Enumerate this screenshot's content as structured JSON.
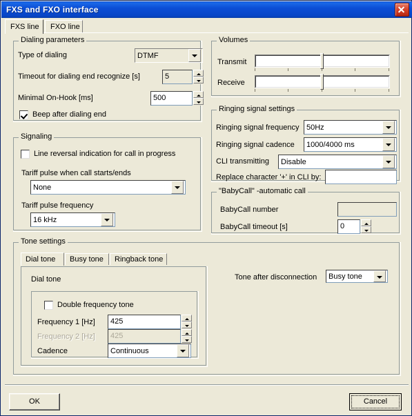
{
  "window": {
    "title": "FXS and FXO interface",
    "close_label": "Close"
  },
  "tabs": [
    {
      "label": "FXS line",
      "selected": true
    },
    {
      "label": "FXO line",
      "selected": false
    }
  ],
  "dialing": {
    "legend": "Dialing parameters",
    "type_label": "Type of dialing",
    "type_value": "DTMF",
    "timeout_label": "Timeout for dialing end recognize [s]",
    "timeout_value": "5",
    "onhook_label": "Minimal On-Hook [ms]",
    "onhook_value": "500",
    "beep_label": "Beep after dialing end",
    "beep_checked": true
  },
  "signaling": {
    "legend": "Signaling",
    "line_reversal_label": "Line reversal indication for call in progress",
    "line_reversal_checked": false,
    "tariff_pulse_label": "Tariff pulse when call starts/ends",
    "tariff_pulse_value": "None",
    "tariff_freq_label": "Tariff pulse frequency",
    "tariff_freq_value": "16 kHz"
  },
  "volumes": {
    "legend": "Volumes",
    "transmit_label": "Transmit",
    "transmit_value": 50,
    "receive_label": "Receive",
    "receive_value": 50
  },
  "ringing": {
    "legend": "Ringing signal settings",
    "freq_label": "Ringing signal frequency",
    "freq_value": "50Hz",
    "cadence_label": "Ringing signal cadence",
    "cadence_value": "1000/4000 ms",
    "cli_label": "CLI transmitting",
    "cli_value": "Disable",
    "replace_label": "Replace character '+' in CLI by:",
    "replace_value": ""
  },
  "babycall": {
    "legend": "\"BabyCall\" -automatic call",
    "number_label": "BabyCall number",
    "number_value": "",
    "timeout_label": "BabyCall timeout [s]",
    "timeout_value": "0"
  },
  "tone_settings": {
    "legend": "Tone settings",
    "tabs": [
      {
        "label": "Dial tone",
        "selected": true
      },
      {
        "label": "Busy tone",
        "selected": false
      },
      {
        "label": "Ringback tone",
        "selected": false
      }
    ],
    "panel_title": "Dial tone",
    "double_freq_label": "Double frequency tone",
    "double_freq_checked": false,
    "freq1_label": "Frequency 1 [Hz]",
    "freq1_value": "425",
    "freq2_label": "Frequency 2 [Hz]",
    "freq2_value": "425",
    "cadence_label": "Cadence",
    "cadence_value": "Continuous",
    "after_disc_label": "Tone after disconnection",
    "after_disc_value": "Busy tone"
  },
  "buttons": {
    "ok": "OK",
    "cancel": "Cancel"
  },
  "colors": {
    "title_bar": "#0a4bd4",
    "face": "#ece9d8",
    "field": "#ffffff",
    "disabled_text": "#aca899",
    "close_red": "#d8452c"
  }
}
